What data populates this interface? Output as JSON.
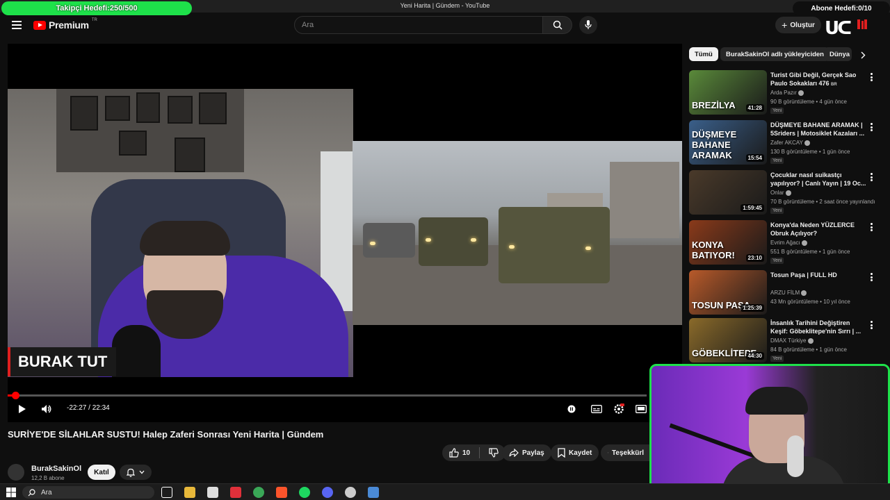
{
  "window": {
    "title": "Yeni Harita | Gündem - YouTube"
  },
  "overlay": {
    "follower_goal": "Takipçi Hedefi:250/500",
    "subscriber_goal": "Abone Hedefi:0/10"
  },
  "header": {
    "logo_text": "Premium",
    "logo_country": "TR",
    "search_placeholder": "Ara",
    "create_label": "Oluştur"
  },
  "player": {
    "name_plate": "BURAK TUT",
    "timecode": "-22:27 / 22:34",
    "progress_fraction": 0.005
  },
  "video": {
    "title": "SURİYE'DE SİLAHLAR SUSTU! Halep Zaferi Sonrası Yeni Harita | Gündem",
    "channel": "BurakSakinOl",
    "subscribers": "12,2 B abone",
    "join_label": "Katıl",
    "like_count": "10",
    "share_label": "Paylaş",
    "save_label": "Kaydet",
    "thanks_label": "Teşekkürl"
  },
  "sidebar": {
    "chips": [
      "Tümü",
      "BurakSakinOl adlı yükleyiciden",
      "Dünya"
    ],
    "items": [
      {
        "title": "Turist Gibi Değil, Gerçek Sao Paulo Sokakları 476 ",
        "flag": "BR",
        "thumb_text": "BREZİLYA",
        "channel": "Arda Pazır",
        "meta": "90 B görüntüleme • 4 gün önce",
        "badge": "Yeni",
        "duration": "41:28",
        "color": "#5a8a3a"
      },
      {
        "title": "DÜŞMEYE BAHANE ARAMAK | 5Sriders | Motosiklet Kazaları ...",
        "flag": "",
        "thumb_text": "DÜŞMEYE BAHANE ARAMAK",
        "channel": "Zafer AKCAY",
        "meta": "130 B görüntüleme • 1 gün önce",
        "badge": "Yeni",
        "duration": "15:54",
        "color": "#3a5f8a"
      },
      {
        "title": "Çocuklar nasıl suikastçı yapılıyor? | Canlı Yayın | 19 Oc...",
        "flag": "",
        "thumb_text": "",
        "channel": "Onlar",
        "meta": "70 B görüntüleme • 2 saat önce yayınlandı",
        "badge": "Yeni",
        "duration": "1:59:45",
        "color": "#4a3a2a"
      },
      {
        "title": "Konya'da Neden YÜZLERCE Obruk Açılıyor?",
        "flag": "",
        "thumb_text": "KONYA BATIYOR!",
        "channel": "Evrim Ağacı",
        "meta": "551 B görüntüleme • 1 gün önce",
        "badge": "Yeni",
        "duration": "23:10",
        "color": "#8a3a1a"
      },
      {
        "title": "Tosun Paşa | FULL HD",
        "flag": "",
        "thumb_text": "TOSUN PAŞA",
        "channel": "ARZU FİLM",
        "meta": "43 Mn görüntüleme • 10 yıl önce",
        "badge": "",
        "duration": "1:25:39",
        "color": "#b85a2a"
      },
      {
        "title": "İnsanlık Tarihini Değiştiren Keşif: Göbeklitepe'nin Sırrı | ...",
        "flag": "",
        "thumb_text": "GÖBEKLİTEPE",
        "channel": "DMAX Türkiye",
        "meta": "84 B görüntüleme • 1 gün önce",
        "badge": "Yeni",
        "duration": "44:30",
        "color": "#8a6a2a"
      }
    ]
  },
  "taskbar": {
    "search_placeholder": "Ara"
  },
  "colors": {
    "accent": "#ff0000",
    "overlay_green": "#1ee14a",
    "background": "#0f0f0f"
  }
}
